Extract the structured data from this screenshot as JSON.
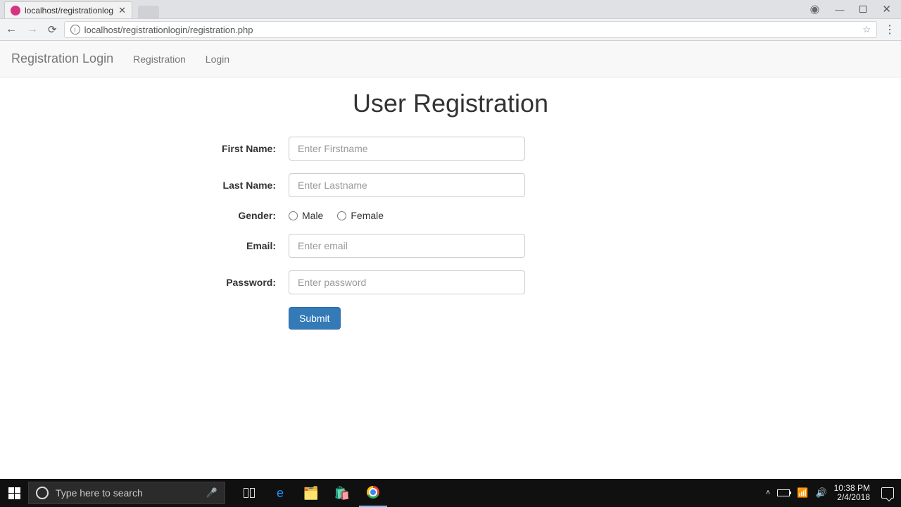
{
  "chrome": {
    "tab_title": "localhost/registrationlog",
    "url": "localhost/registrationlogin/registration.php",
    "sym": {
      "back": "←",
      "forward": "→",
      "reload": "⟳",
      "info": "i",
      "star": "☆",
      "account": "◉",
      "min": "—",
      "close": "✕",
      "more": "⋮"
    }
  },
  "navbar": {
    "brand": "Registration Login",
    "link1": "Registration",
    "link2": "Login"
  },
  "page": {
    "heading": "User Registration",
    "labels": {
      "first": "First Name:",
      "last": "Last Name:",
      "gender": "Gender:",
      "email": "Email:",
      "password": "Password:"
    },
    "placeholders": {
      "first": "Enter Firstname",
      "last": "Enter Lastname",
      "email": "Enter email",
      "password": "Enter password"
    },
    "gender": {
      "male": "Male",
      "female": "Female"
    },
    "submit": "Submit"
  },
  "taskbar": {
    "search_placeholder": "Type here to search",
    "mic": "🎤",
    "tray": {
      "chev": "˄",
      "wifi": "📶",
      "vol": "🔊",
      "time": "10:38 PM",
      "date": "2/4/2018"
    }
  }
}
